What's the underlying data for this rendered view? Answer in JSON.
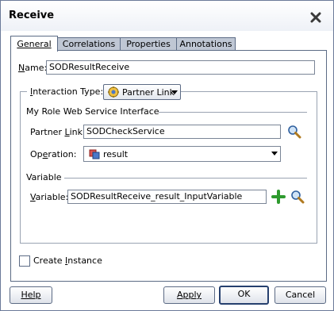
{
  "dialog": {
    "title": "Receive",
    "close_icon": "close-x-icon"
  },
  "tabs": [
    {
      "label": "General",
      "active": true
    },
    {
      "label": "Correlations",
      "active": false
    },
    {
      "label": "Properties",
      "active": false
    },
    {
      "label": "Annotations",
      "active": false
    }
  ],
  "general": {
    "name_label": "Name:",
    "name_value": "SODResultReceive",
    "interaction_type_label": "Interaction Type:",
    "interaction_type_value": "Partner Link",
    "role_group_title": "My Role Web Service Interface",
    "partner_link_label": "Partner Link:",
    "partner_link_value": "SODCheckService",
    "operation_label": "Operation:",
    "operation_value": "result",
    "variable_group_title": "Variable",
    "variable_label": "Variable:",
    "variable_value": "SODResultReceive_result_InputVariable",
    "create_instance_label": "Create Instance",
    "create_instance_checked": false
  },
  "buttons": {
    "help": "Help",
    "apply": "Apply",
    "ok": "OK",
    "cancel": "Cancel"
  },
  "icons": {
    "partner_link_search": "search-icon",
    "variable_add": "plus-icon",
    "variable_search": "search-icon",
    "interaction_type": "partner-link-icon",
    "operation": "operation-icon"
  }
}
